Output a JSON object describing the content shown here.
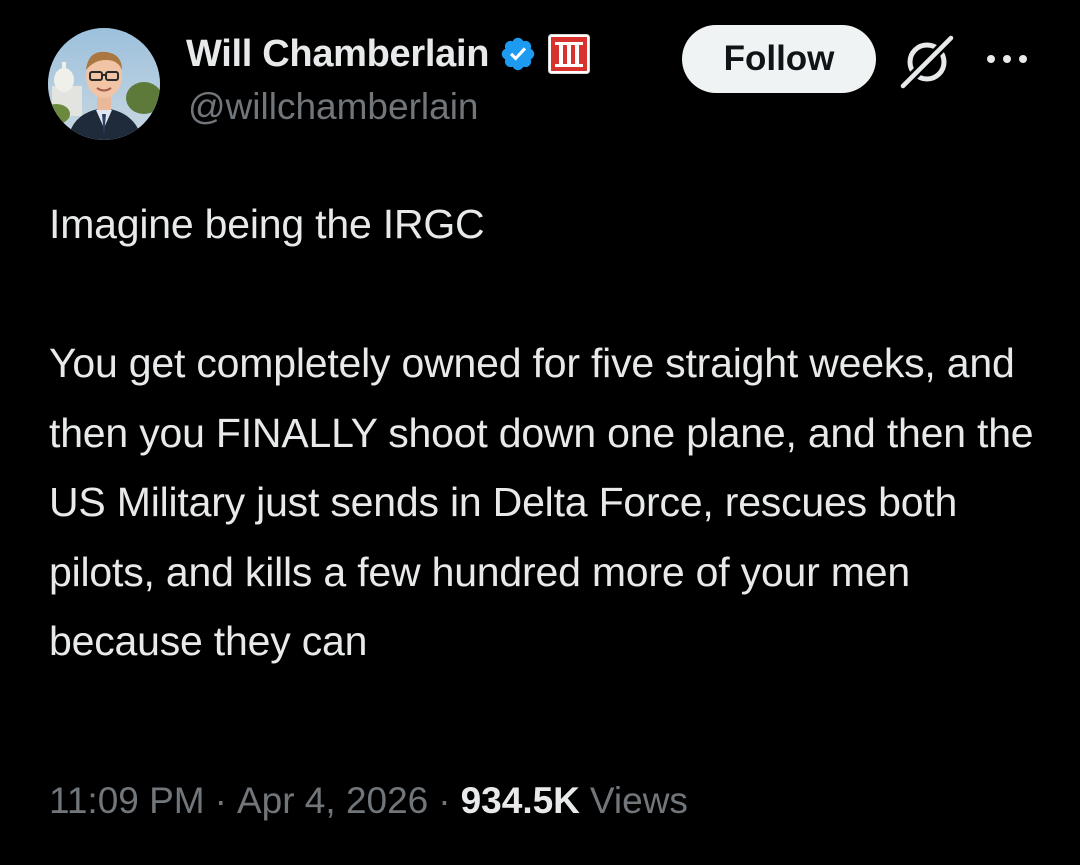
{
  "author": {
    "display_name": "Will Chamberlain",
    "handle": "@willchamberlain",
    "avatar_icon": "profile-photo",
    "verified_icon": "verified-badge-icon",
    "affiliate_icon": "roman-numeral-iii-badge-icon",
    "verified_color": "#1d9bf0",
    "affiliate_color": "#e0245e"
  },
  "actions": {
    "follow_label": "Follow",
    "grok_icon": "grok-icon",
    "more_icon": "more-options-icon"
  },
  "tweet": {
    "paragraphs": [
      "Imagine being the IRGC",
      "You get completely owned for five straight weeks, and then you FINALLY shoot down one plane, and then the US Military just sends in Delta Force, rescues both pilots, and kills a few hundred more of your men because they can"
    ]
  },
  "meta": {
    "time": "11:09 PM",
    "separator": "·",
    "date": "Apr 4, 2026",
    "views_count": "934.5K",
    "views_label": "Views"
  },
  "colors": {
    "background": "#000000",
    "text_primary": "#e7e9ea",
    "text_secondary": "#71767b",
    "follow_bg": "#eff3f4",
    "follow_text": "#0f1419"
  }
}
